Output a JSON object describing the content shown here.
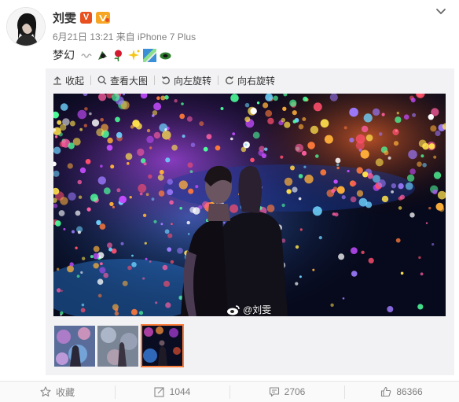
{
  "post": {
    "user_name": "刘雯",
    "verified_badge": "V",
    "meta": "6月21日 13:21 来自 iPhone 7 Plus",
    "text": "梦幻",
    "emoji_icons": [
      "hand-icon",
      "rose-icon",
      "sparkles-icon",
      "rainbow-icon",
      "leaf-icon"
    ]
  },
  "media_toolbar": {
    "collapse": "收起",
    "view_large": "查看大图",
    "rotate_left": "向左旋转",
    "rotate_right": "向右旋转"
  },
  "photo": {
    "watermark": "@刘雯"
  },
  "thumbnails": {
    "count": 3,
    "selected_index": 3
  },
  "actions": {
    "favorite": "收藏",
    "repost": "1044",
    "comment": "2706",
    "like": "86366"
  },
  "colors": {
    "verified_badge": "#e8501f",
    "selected_thumb_border": "#fa7d3c",
    "muted_text": "#808080"
  }
}
